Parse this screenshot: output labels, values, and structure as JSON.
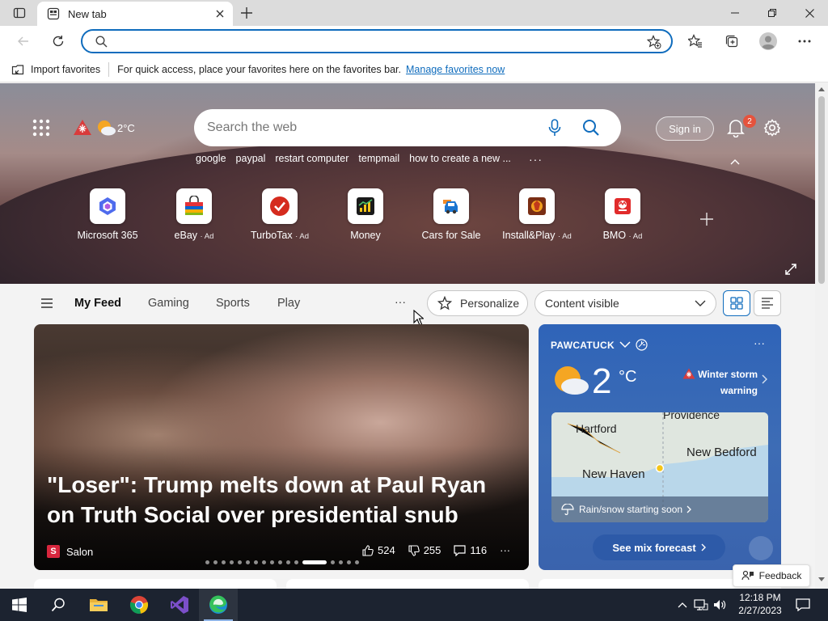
{
  "browser": {
    "tab": {
      "title": "New tab"
    },
    "address": {
      "value": "",
      "placeholder": ""
    },
    "favorites_bar": {
      "import_label": "Import favorites",
      "message": "For quick access, place your favorites here on the favorites bar.",
      "manage_link": "Manage favorites now"
    }
  },
  "hero": {
    "weather_temp": "2°C",
    "search_placeholder": "Search the web",
    "trending": [
      "google",
      "paypal",
      "restart computer",
      "tempmail",
      "how to create a new ..."
    ],
    "trending_more": "···",
    "signin_label": "Sign in",
    "notification_count": "2",
    "quick_links": [
      {
        "label": "Microsoft 365",
        "ad": "",
        "icon": "microsoft-365-icon"
      },
      {
        "label": "eBay",
        "ad": "· Ad",
        "icon": "ebay-icon"
      },
      {
        "label": "TurboTax",
        "ad": "· Ad",
        "icon": "turbotax-icon"
      },
      {
        "label": "Money",
        "ad": "",
        "icon": "money-icon"
      },
      {
        "label": "Cars for Sale",
        "ad": "",
        "icon": "cars-icon"
      },
      {
        "label": "Install&Play",
        "ad": "· Ad",
        "icon": "install-play-icon"
      },
      {
        "label": "BMO",
        "ad": "· Ad",
        "icon": "bmo-icon"
      }
    ]
  },
  "feed": {
    "tabs": [
      "My Feed",
      "Gaming",
      "Sports",
      "Play"
    ],
    "more": "···",
    "personalize_label": "Personalize",
    "content_visibility": "Content visible"
  },
  "article": {
    "headline": "\"Loser\": Trump melts down at Paul Ryan on Truth Social over presidential snub",
    "source": "Salon",
    "source_initial": "S",
    "likes": "524",
    "dislikes": "255",
    "comments": "116",
    "more": "···"
  },
  "weather": {
    "location": "PAWCATUCK",
    "temp": "2",
    "unit": "°C",
    "alert": "Winter storm warning",
    "map_labels": [
      "Hartford",
      "Providence",
      "New Bedford",
      "New Haven"
    ],
    "precip": "Rain/snow starting soon",
    "forecast_button": "See mix forecast",
    "more": "···"
  },
  "feedback_label": "Feedback",
  "taskbar": {
    "time": "12:18 PM",
    "date": "2/27/2023"
  },
  "colors": {
    "accent": "#0f6cbd",
    "taskbar": "#1c2330",
    "weather_card": "#2f64b8",
    "alert": "#e5533d"
  }
}
